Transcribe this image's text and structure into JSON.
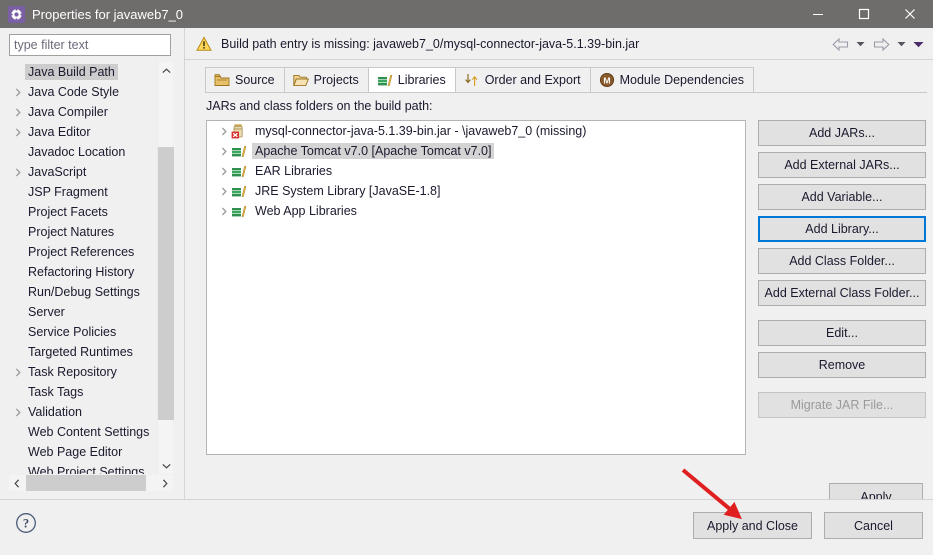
{
  "window": {
    "title": "Properties for javaweb7_0",
    "icon": "gear-icon",
    "minimize": "—",
    "maximize": "□",
    "close": "✕"
  },
  "sidebar": {
    "filter": {
      "value": "",
      "placeholder": "type filter text"
    },
    "items": [
      {
        "label": "Java Build Path",
        "expandable": false,
        "selected": true
      },
      {
        "label": "Java Code Style",
        "expandable": true,
        "selected": false
      },
      {
        "label": "Java Compiler",
        "expandable": true,
        "selected": false
      },
      {
        "label": "Java Editor",
        "expandable": true,
        "selected": false
      },
      {
        "label": "Javadoc Location",
        "expandable": false,
        "selected": false
      },
      {
        "label": "JavaScript",
        "expandable": true,
        "selected": false
      },
      {
        "label": "JSP Fragment",
        "expandable": false,
        "selected": false
      },
      {
        "label": "Project Facets",
        "expandable": false,
        "selected": false
      },
      {
        "label": "Project Natures",
        "expandable": false,
        "selected": false
      },
      {
        "label": "Project References",
        "expandable": false,
        "selected": false
      },
      {
        "label": "Refactoring History",
        "expandable": false,
        "selected": false
      },
      {
        "label": "Run/Debug Settings",
        "expandable": false,
        "selected": false
      },
      {
        "label": "Server",
        "expandable": false,
        "selected": false
      },
      {
        "label": "Service Policies",
        "expandable": false,
        "selected": false
      },
      {
        "label": "Targeted Runtimes",
        "expandable": false,
        "selected": false
      },
      {
        "label": "Task Repository",
        "expandable": true,
        "selected": false
      },
      {
        "label": "Task Tags",
        "expandable": false,
        "selected": false
      },
      {
        "label": "Validation",
        "expandable": true,
        "selected": false
      },
      {
        "label": "Web Content Settings",
        "expandable": false,
        "selected": false
      },
      {
        "label": "Web Page Editor",
        "expandable": false,
        "selected": false
      },
      {
        "label": "Web Project Settings",
        "expandable": false,
        "selected": false
      }
    ]
  },
  "message": {
    "icon": "warning-icon",
    "text": "Build path entry is missing: javaweb7_0/mysql-connector-java-5.1.39-bin.jar"
  },
  "navigation": {
    "back": "back-arrow-icon",
    "forward": "forward-arrow-icon",
    "menu": "dropdown-caret-icon"
  },
  "tabs": [
    {
      "label": "Source",
      "icon": "package-icon",
      "active": false
    },
    {
      "label": "Projects",
      "icon": "open-folder-icon",
      "active": false
    },
    {
      "label": "Libraries",
      "icon": "library-books-icon",
      "active": true
    },
    {
      "label": "Order and Export",
      "icon": "updown-arrows-icon",
      "active": false
    },
    {
      "label": "Module Dependencies",
      "icon": "module-m-icon",
      "active": false
    }
  ],
  "libraries": {
    "caption": "JARs and class folders on the build path:",
    "entries": [
      {
        "label": "mysql-connector-java-5.1.39-bin.jar - \\javaweb7_0 (missing)",
        "icon": "jar-error-icon",
        "selected": false
      },
      {
        "label": "Apache Tomcat v7.0 [Apache Tomcat v7.0]",
        "icon": "library-books-icon",
        "selected": true
      },
      {
        "label": "EAR Libraries",
        "icon": "library-books-icon",
        "selected": false
      },
      {
        "label": "JRE System Library [JavaSE-1.8]",
        "icon": "library-books-icon",
        "selected": false
      },
      {
        "label": "Web App Libraries",
        "icon": "library-books-icon",
        "selected": false
      }
    ]
  },
  "side_buttons": [
    {
      "label": "Add JARs...",
      "focused": false,
      "disabled": false
    },
    {
      "label": "Add External JARs...",
      "focused": false,
      "disabled": false
    },
    {
      "label": "Add Variable...",
      "focused": false,
      "disabled": false
    },
    {
      "label": "Add Library...",
      "focused": true,
      "disabled": false
    },
    {
      "label": "Add Class Folder...",
      "focused": false,
      "disabled": false
    },
    {
      "label": "Add External Class Folder...",
      "focused": false,
      "disabled": false
    },
    {
      "label": "Edit...",
      "focused": false,
      "disabled": false
    },
    {
      "label": "Remove",
      "focused": false,
      "disabled": false
    },
    {
      "label": "Migrate JAR File...",
      "focused": false,
      "disabled": true
    }
  ],
  "footer": {
    "help": "help-icon",
    "apply": "Apply",
    "apply_and_close": "Apply and Close",
    "cancel": "Cancel"
  },
  "annotation": {
    "type": "arrow",
    "color": "#e02020",
    "points_to": "Apply and Close"
  },
  "colors": {
    "titlebar": "#6f6c6c",
    "dialog_bg": "#f0f0f0",
    "focus_blue": "#0078d7",
    "selection_grey": "#d4d4d4",
    "annotation_red": "#e02020"
  }
}
